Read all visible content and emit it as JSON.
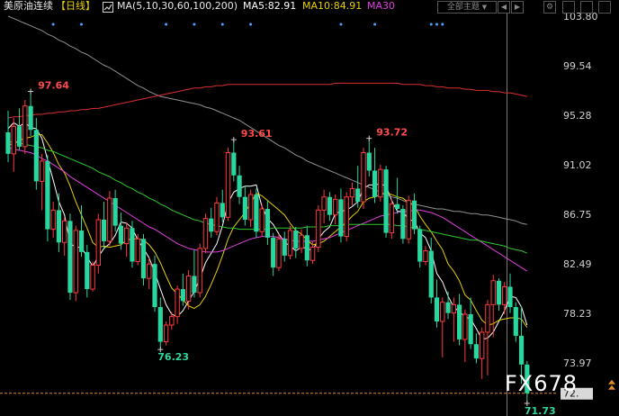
{
  "header": {
    "symbol": "美原油连续",
    "period": "【日线】",
    "ma_params": "MA(5,10,30,60,100,200)",
    "ma5": "MA5:82.91",
    "ma10": "MA10:84.91",
    "ma30": "MA30",
    "theme_button": "全部主题",
    "theme_arrow": "▼"
  },
  "watermark": "FX678",
  "colors": {
    "up": "#ff3b3b",
    "down": "#28d7a0",
    "ma5": "#ffffff",
    "ma10": "#e8d000",
    "ma30": "#e040e0",
    "ma60": "#2ec82e",
    "ma100": "#909090",
    "ma200": "#d83030"
  },
  "chart_data": {
    "type": "candlestick",
    "y_ticks": [
      "103.80",
      "99.54",
      "95.28",
      "91.02",
      "86.75",
      "82.49",
      "78.23",
      "73.97"
    ],
    "ylim": [
      70.6,
      104.3
    ],
    "current_price_label": "72.",
    "current_price": 72.5,
    "annotations": [
      {
        "label": "97.64",
        "i": 4,
        "value": 97.64,
        "type": "high"
      },
      {
        "label": "93.61",
        "i": 40,
        "value": 93.61,
        "type": "high"
      },
      {
        "label": "76.23",
        "i": 27,
        "value": 76.23,
        "type": "low"
      },
      {
        "label": "93.72",
        "i": 64,
        "value": 93.72,
        "type": "high"
      },
      {
        "label": "71.73",
        "i": 92,
        "value": 71.73,
        "type": "low"
      }
    ],
    "candles": [
      [
        94.3,
        96.1,
        91.8,
        92.5
      ],
      [
        92.5,
        95.5,
        91.0,
        94.8
      ],
      [
        94.8,
        96.3,
        92.8,
        93.1
      ],
      [
        93.1,
        97.0,
        92.5,
        96.5
      ],
      [
        96.5,
        97.64,
        94.0,
        94.5
      ],
      [
        94.5,
        95.5,
        89.5,
        90.2
      ],
      [
        90.2,
        92.5,
        87.8,
        91.9
      ],
      [
        91.9,
        92.4,
        85.2,
        86.2
      ],
      [
        86.2,
        88.5,
        85.5,
        87.8
      ],
      [
        87.8,
        89.2,
        84.3,
        85.1
      ],
      [
        85.1,
        87.2,
        84.0,
        86.9
      ],
      [
        86.9,
        87.5,
        80.3,
        80.9
      ],
      [
        80.9,
        86.5,
        80.2,
        86.1
      ],
      [
        86.1,
        88.2,
        83.9,
        84.3
      ],
      [
        84.3,
        84.9,
        80.5,
        81.2
      ],
      [
        81.2,
        83.5,
        81.0,
        83.2
      ],
      [
        83.2,
        87.5,
        82.5,
        87.0
      ],
      [
        87.0,
        88.5,
        84.6,
        85.2
      ],
      [
        85.2,
        89.4,
        84.8,
        88.8
      ],
      [
        88.8,
        89.5,
        86.0,
        86.5
      ],
      [
        86.5,
        87.6,
        84.5,
        85.0
      ],
      [
        85.0,
        86.8,
        83.9,
        86.3
      ],
      [
        86.3,
        86.9,
        83.0,
        83.5
      ],
      [
        83.5,
        85.8,
        83.2,
        85.4
      ],
      [
        85.4,
        85.8,
        81.5,
        82.1
      ],
      [
        82.1,
        83.8,
        81.2,
        83.3
      ],
      [
        83.3,
        84.0,
        79.3,
        79.7
      ],
      [
        79.7,
        80.5,
        76.23,
        76.8
      ],
      [
        76.8,
        78.5,
        76.5,
        78.2
      ],
      [
        78.2,
        79.3,
        77.8,
        78.9
      ],
      [
        78.9,
        81.5,
        78.3,
        81.2
      ],
      [
        81.2,
        82.5,
        79.8,
        80.2
      ],
      [
        80.2,
        82.8,
        79.5,
        82.3
      ],
      [
        82.3,
        84.5,
        80.5,
        80.9
      ],
      [
        80.9,
        85.0,
        80.5,
        84.6
      ],
      [
        84.6,
        87.5,
        84.2,
        87.1
      ],
      [
        87.1,
        88.0,
        85.5,
        86.0
      ],
      [
        86.0,
        88.9,
        85.7,
        88.4
      ],
      [
        88.4,
        89.5,
        86.8,
        87.2
      ],
      [
        87.2,
        93.0,
        86.9,
        92.6
      ],
      [
        92.6,
        93.61,
        90.2,
        90.7
      ],
      [
        90.7,
        91.5,
        88.3,
        88.9
      ],
      [
        88.9,
        89.8,
        86.5,
        87.0
      ],
      [
        87.0,
        89.5,
        86.4,
        89.1
      ],
      [
        89.1,
        89.6,
        85.5,
        86.0
      ],
      [
        86.0,
        88.3,
        85.6,
        87.9
      ],
      [
        87.9,
        88.6,
        84.9,
        85.5
      ],
      [
        85.5,
        85.9,
        82.3,
        83.0
      ],
      [
        83.0,
        85.8,
        82.7,
        85.4
      ],
      [
        85.4,
        86.0,
        83.5,
        84.0
      ],
      [
        84.0,
        86.5,
        83.7,
        86.1
      ],
      [
        86.1,
        86.4,
        83.8,
        84.6
      ],
      [
        84.6,
        86.2,
        84.2,
        85.7
      ],
      [
        85.7,
        86.5,
        83.1,
        83.6
      ],
      [
        83.6,
        85.2,
        83.3,
        84.7
      ],
      [
        84.7,
        88.2,
        84.3,
        87.8
      ],
      [
        87.8,
        89.5,
        86.7,
        88.9
      ],
      [
        88.9,
        89.3,
        86.9,
        87.4
      ],
      [
        87.4,
        89.1,
        86.6,
        88.7
      ],
      [
        88.7,
        89.6,
        85.1,
        85.6
      ],
      [
        85.6,
        89.3,
        85.2,
        88.9
      ],
      [
        88.9,
        90.1,
        88.2,
        89.6
      ],
      [
        89.6,
        91.5,
        88.0,
        88.5
      ],
      [
        88.5,
        93.0,
        87.9,
        92.6
      ],
      [
        92.6,
        93.72,
        90.6,
        91.1
      ],
      [
        91.1,
        93.0,
        88.4,
        88.9
      ],
      [
        88.9,
        91.6,
        88.5,
        91.2
      ],
      [
        91.2,
        91.5,
        85.5,
        85.9
      ],
      [
        85.9,
        88.7,
        85.4,
        88.3
      ],
      [
        88.3,
        90.5,
        87.5,
        87.9
      ],
      [
        87.9,
        88.2,
        85.0,
        85.4
      ],
      [
        85.4,
        89.0,
        85.0,
        88.6
      ],
      [
        88.6,
        89.2,
        85.8,
        86.2
      ],
      [
        86.2,
        86.5,
        83.0,
        83.5
      ],
      [
        83.5,
        84.8,
        83.2,
        84.4
      ],
      [
        84.4,
        85.5,
        80.0,
        80.5
      ],
      [
        80.5,
        82.0,
        78.0,
        78.5
      ],
      [
        78.5,
        80.5,
        75.5,
        80.1
      ],
      [
        80.1,
        81.0,
        78.7,
        79.2
      ],
      [
        79.2,
        80.5,
        76.8,
        79.9
      ],
      [
        79.9,
        80.8,
        76.5,
        77.0
      ],
      [
        77.0,
        79.5,
        75.1,
        79.1
      ],
      [
        79.1,
        80.5,
        76.2,
        76.6
      ],
      [
        76.6,
        77.5,
        75.0,
        75.4
      ],
      [
        75.4,
        78.0,
        73.7,
        77.6
      ],
      [
        77.6,
        80.3,
        74.0,
        79.9
      ],
      [
        79.9,
        82.4,
        77.2,
        81.9
      ],
      [
        81.9,
        82.1,
        79.4,
        79.9
      ],
      [
        79.9,
        81.8,
        79.1,
        81.4
      ],
      [
        81.4,
        82.5,
        79.2,
        79.7
      ],
      [
        79.7,
        80.1,
        76.8,
        77.3
      ],
      [
        77.3,
        79.8,
        73.3,
        74.9
      ],
      [
        74.9,
        75.2,
        71.73,
        72.5
      ]
    ],
    "ma_series": [
      {
        "name": "MA5",
        "color": "#ffffff",
        "values": [
          94.6,
          95.1,
          94.8,
          95.1,
          94.7,
          94.6,
          93.8,
          92.0,
          90.3,
          88.5,
          87.4,
          85.0,
          84.7,
          84.7,
          83.9,
          83.1,
          83.9,
          84.6,
          85.0,
          85.7,
          86.8,
          86.7,
          86.3,
          85.3,
          84.6,
          83.8,
          82.6,
          81.2,
          79.9,
          79.1,
          78.9,
          79.4,
          80.2,
          81.0,
          82.1,
          83.4,
          84.2,
          85.0,
          86.5,
          88.4,
          89.3,
          89.6,
          89.8,
          89.8,
          89.9,
          88.1,
          87.1,
          86.6,
          85.8,
          85.1,
          84.8,
          84.4,
          84.7,
          84.6,
          84.4,
          85.4,
          86.0,
          86.4,
          87.5,
          87.7,
          87.8,
          88.1,
          88.5,
          89.6,
          89.9,
          89.9,
          90.0,
          89.8,
          88.6,
          87.7,
          87.7,
          87.0,
          86.9,
          85.9,
          85.5,
          84.4,
          82.5,
          81.8,
          80.6,
          79.7,
          79.3,
          78.9,
          78.7,
          77.9,
          77.0,
          77.1,
          77.6,
          78.5,
          79.4,
          80.6,
          80.5,
          79.7,
          78.2
        ]
      },
      {
        "name": "MA10",
        "color": "#e8d000",
        "values": [
          93.2,
          93.4,
          93.6,
          93.8,
          93.9,
          94.1,
          94.1,
          93.4,
          92.6,
          91.6,
          90.9,
          89.8,
          88.5,
          87.4,
          86.3,
          85.1,
          84.7,
          84.8,
          84.7,
          84.8,
          84.9,
          85.3,
          85.4,
          85.4,
          85.3,
          84.9,
          84.3,
          83.4,
          82.3,
          81.3,
          80.8,
          80.3,
          79.8,
          79.6,
          79.9,
          80.6,
          81.6,
          82.7,
          84.0,
          85.4,
          86.4,
          87.0,
          87.6,
          88.4,
          89.2,
          89.0,
          88.6,
          88.2,
          87.8,
          87.4,
          86.7,
          86.1,
          85.8,
          85.3,
          84.9,
          85.0,
          85.2,
          85.6,
          86.0,
          86.4,
          86.8,
          87.3,
          87.7,
          88.5,
          88.8,
          88.9,
          89.1,
          89.2,
          89.1,
          88.9,
          88.8,
          88.4,
          88.2,
          87.3,
          86.6,
          86.0,
          85.2,
          84.5,
          83.3,
          82.7,
          81.9,
          80.7,
          80.3,
          79.4,
          78.6,
          78.2,
          78.3,
          78.6,
          78.7,
          78.8,
          78.8,
          78.7,
          78.0
        ]
      },
      {
        "name": "MA30",
        "color": "#e040e0",
        "values": [
          93.0,
          92.9,
          92.8,
          92.7,
          92.6,
          92.4,
          92.1,
          91.9,
          91.6,
          91.3,
          91.0,
          90.6,
          90.3,
          90.0,
          89.7,
          89.4,
          89.1,
          88.8,
          88.5,
          88.2,
          87.9,
          87.6,
          87.3,
          87.0,
          86.7,
          86.4,
          86.2,
          85.9,
          85.6,
          85.3,
          85.0,
          84.8,
          84.6,
          84.5,
          84.4,
          84.3,
          84.3,
          84.3,
          84.4,
          84.6,
          84.8,
          85.0,
          85.2,
          85.4,
          85.5,
          85.6,
          85.6,
          85.6,
          85.5,
          85.4,
          85.3,
          85.2,
          85.2,
          85.2,
          85.2,
          85.3,
          85.4,
          85.5,
          85.7,
          85.9,
          86.1,
          86.3,
          86.5,
          86.7,
          86.9,
          87.1,
          87.3,
          87.4,
          87.5,
          87.6,
          87.7,
          87.7,
          87.8,
          87.8,
          87.7,
          87.6,
          87.4,
          87.2,
          86.9,
          86.6,
          86.3,
          86.0,
          85.7,
          85.4,
          85.1,
          84.8,
          84.5,
          84.2,
          83.9,
          83.6,
          83.3,
          83.0,
          82.7
        ]
      },
      {
        "name": "MA60",
        "color": "#2ec82e",
        "values": [
          93.5,
          93.5,
          93.4,
          93.3,
          93.2,
          93.1,
          93.0,
          92.8,
          92.7,
          92.5,
          92.3,
          92.1,
          91.9,
          91.7,
          91.5,
          91.3,
          91.0,
          90.8,
          90.6,
          90.3,
          90.1,
          89.8,
          89.6,
          89.3,
          89.1,
          88.8,
          88.6,
          88.3,
          88.1,
          87.8,
          87.6,
          87.4,
          87.2,
          87.0,
          86.9,
          86.7,
          86.6,
          86.5,
          86.4,
          86.3,
          86.3,
          86.2,
          86.2,
          86.2,
          86.2,
          86.2,
          86.2,
          86.3,
          86.3,
          86.3,
          86.3,
          86.3,
          86.3,
          86.4,
          86.4,
          86.4,
          86.4,
          86.5,
          86.5,
          86.5,
          86.6,
          86.6,
          86.6,
          86.6,
          86.6,
          86.6,
          86.6,
          86.6,
          86.6,
          86.5,
          86.5,
          86.4,
          86.3,
          86.2,
          86.1,
          86.0,
          85.9,
          85.8,
          85.7,
          85.6,
          85.5,
          85.4,
          85.3,
          85.3,
          85.2,
          85.1,
          85.0,
          84.9,
          84.8,
          84.6,
          84.5,
          84.4,
          84.2
        ]
      },
      {
        "name": "MA100",
        "color": "#909090",
        "values": [
          104.0,
          103.8,
          103.6,
          103.4,
          103.2,
          103.0,
          102.8,
          102.5,
          102.3,
          102.0,
          101.8,
          101.5,
          101.3,
          101.0,
          100.8,
          100.5,
          100.2,
          99.9,
          99.7,
          99.4,
          99.1,
          98.8,
          98.5,
          98.2,
          98.0,
          97.7,
          97.5,
          97.3,
          97.2,
          97.1,
          97.0,
          96.9,
          96.8,
          96.7,
          96.6,
          96.4,
          96.3,
          96.1,
          95.9,
          95.7,
          95.5,
          95.3,
          95.0,
          94.7,
          94.4,
          94.1,
          93.8,
          93.5,
          93.2,
          93.0,
          92.7,
          92.4,
          92.2,
          91.9,
          91.7,
          91.5,
          91.3,
          91.1,
          90.9,
          90.7,
          90.5,
          90.3,
          90.1,
          89.9,
          89.7,
          89.5,
          89.3,
          89.1,
          88.9,
          88.8,
          88.6,
          88.4,
          88.3,
          88.2,
          88.1,
          88.0,
          87.9,
          87.9,
          87.8,
          87.7,
          87.7,
          87.6,
          87.5,
          87.5,
          87.4,
          87.4,
          87.3,
          87.2,
          87.1,
          87.0,
          86.9,
          86.7,
          86.6
        ]
      },
      {
        "name": "MA200",
        "color": "#d83030",
        "values": [
          95.5,
          95.6,
          95.6,
          95.7,
          95.7,
          95.8,
          95.8,
          95.9,
          95.9,
          96.0,
          96.0,
          96.1,
          96.1,
          96.2,
          96.2,
          96.3,
          96.3,
          96.4,
          96.5,
          96.6,
          96.7,
          96.8,
          96.9,
          97.0,
          97.1,
          97.2,
          97.3,
          97.4,
          97.5,
          97.6,
          97.7,
          97.8,
          97.9,
          98.0,
          98.0,
          98.1,
          98.1,
          98.2,
          98.2,
          98.3,
          98.3,
          98.3,
          98.3,
          98.3,
          98.3,
          98.3,
          98.3,
          98.3,
          98.3,
          98.3,
          98.3,
          98.3,
          98.3,
          98.3,
          98.3,
          98.3,
          98.3,
          98.3,
          98.4,
          98.4,
          98.4,
          98.4,
          98.4,
          98.4,
          98.4,
          98.4,
          98.4,
          98.4,
          98.4,
          98.4,
          98.3,
          98.3,
          98.3,
          98.3,
          98.2,
          98.2,
          98.1,
          98.1,
          98.0,
          98.0,
          98.0,
          97.9,
          97.9,
          97.8,
          97.8,
          97.8,
          97.7,
          97.7,
          97.6,
          97.6,
          97.5,
          97.4,
          97.3
        ]
      }
    ]
  }
}
